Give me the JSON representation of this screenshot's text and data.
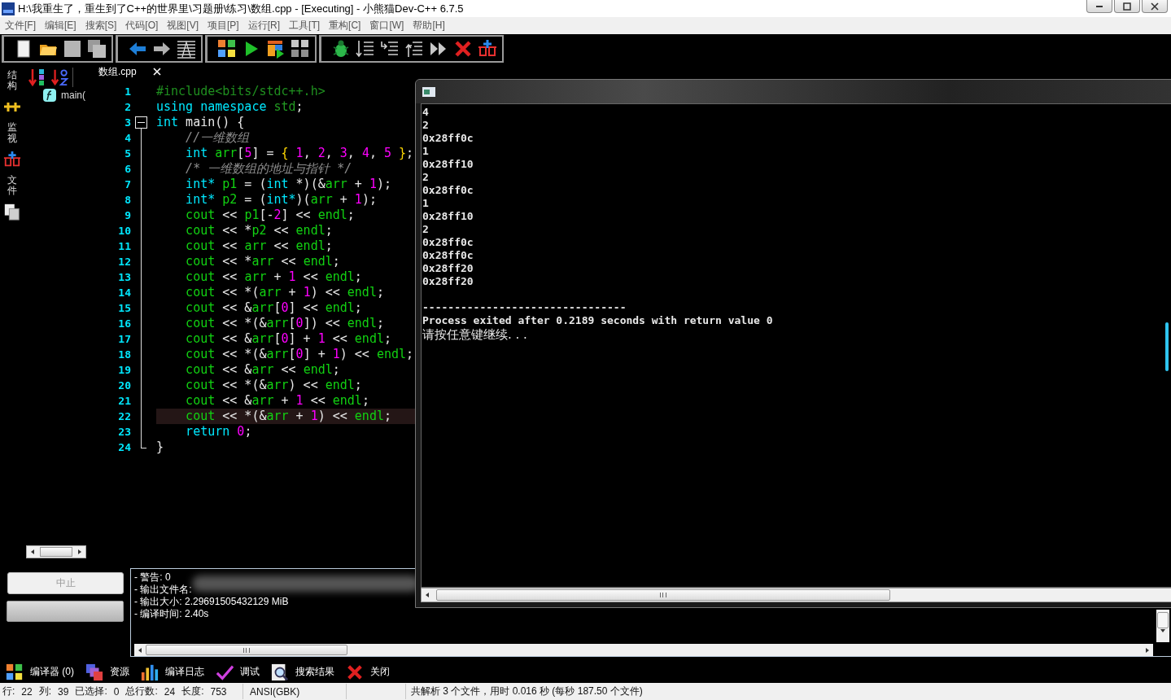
{
  "window": {
    "title": "H:\\我重生了，重生到了C++的世界里\\习题册\\练习\\数组.cpp - [Executing] - 小熊猫Dev-C++ 6.7.5"
  },
  "menu": [
    "文件[F]",
    "编辑[E]",
    "搜索[S]",
    "代码[O]",
    "视图[V]",
    "项目[P]",
    "运行[R]",
    "工具[T]",
    "重构[C]",
    "窗口[W]",
    "帮助[H]"
  ],
  "side_tabs": [
    {
      "kind": "text",
      "label": "结构"
    },
    {
      "kind": "icon"
    },
    {
      "kind": "text",
      "label": "监视"
    },
    {
      "kind": "icon"
    },
    {
      "kind": "text",
      "label": "文件"
    },
    {
      "kind": "icon"
    }
  ],
  "class_browser": {
    "items": [
      {
        "label": "main("
      }
    ]
  },
  "editor": {
    "tab": {
      "label": "数组.cpp"
    },
    "lines": [
      {
        "number": "1",
        "kind": "plain",
        "current": false,
        "tokens": [
          {
            "t": "#include<bits/stdc++.h>",
            "kind": "pre"
          }
        ]
      },
      {
        "number": "2",
        "kind": "plain",
        "current": false,
        "tokens": [
          {
            "t": "using namespace ",
            "kind": "kw"
          },
          {
            "t": "std",
            "kind": "ns"
          },
          {
            "t": ";",
            "kind": "op"
          }
        ]
      },
      {
        "number": "3",
        "kind": "fold-start",
        "current": false,
        "tokens": [
          {
            "t": "int",
            "kind": "kw"
          },
          {
            "t": " main() {",
            "kind": "op"
          }
        ]
      },
      {
        "number": "4",
        "kind": "fold-body",
        "current": false,
        "tokens": [
          {
            "t": "    //一维数组",
            "kind": "cm"
          }
        ]
      },
      {
        "number": "5",
        "kind": "fold-body",
        "current": false,
        "tokens": [
          {
            "t": "    int ",
            "kind": "kw"
          },
          {
            "t": "arr",
            "kind": "id"
          },
          {
            "t": "[",
            "kind": "op"
          },
          {
            "t": "5",
            "kind": "num"
          },
          {
            "t": "] = ",
            "kind": "op"
          },
          {
            "t": "{ ",
            "kind": "br"
          },
          {
            "t": "1",
            "kind": "num"
          },
          {
            "t": ", ",
            "kind": "op"
          },
          {
            "t": "2",
            "kind": "num"
          },
          {
            "t": ", ",
            "kind": "op"
          },
          {
            "t": "3",
            "kind": "num"
          },
          {
            "t": ", ",
            "kind": "op"
          },
          {
            "t": "4",
            "kind": "num"
          },
          {
            "t": ", ",
            "kind": "op"
          },
          {
            "t": "5 ",
            "kind": "num"
          },
          {
            "t": "}",
            "kind": "br"
          },
          {
            "t": ";",
            "kind": "op"
          }
        ]
      },
      {
        "number": "6",
        "kind": "fold-body",
        "current": false,
        "tokens": [
          {
            "t": "    /* 一维数组的地址与指针 */",
            "kind": "cm"
          }
        ]
      },
      {
        "number": "7",
        "kind": "fold-body",
        "current": false,
        "tokens": [
          {
            "t": "    int* ",
            "kind": "kw"
          },
          {
            "t": "p1",
            "kind": "id"
          },
          {
            "t": " = (",
            "kind": "op"
          },
          {
            "t": "int",
            "kind": "kw"
          },
          {
            "t": " *)(&",
            "kind": "op"
          },
          {
            "t": "arr",
            "kind": "id"
          },
          {
            "t": " + ",
            "kind": "op"
          },
          {
            "t": "1",
            "kind": "num"
          },
          {
            "t": ");",
            "kind": "op"
          }
        ]
      },
      {
        "number": "8",
        "kind": "fold-body",
        "current": false,
        "tokens": [
          {
            "t": "    int* ",
            "kind": "kw"
          },
          {
            "t": "p2",
            "kind": "id"
          },
          {
            "t": " = (",
            "kind": "op"
          },
          {
            "t": "int*",
            "kind": "kw"
          },
          {
            "t": ")(",
            "kind": "op"
          },
          {
            "t": "arr",
            "kind": "id"
          },
          {
            "t": " + ",
            "kind": "op"
          },
          {
            "t": "1",
            "kind": "num"
          },
          {
            "t": ");",
            "kind": "op"
          }
        ]
      },
      {
        "number": "9",
        "kind": "fold-body",
        "current": false,
        "tokens": [
          {
            "t": "    cout",
            "kind": "id"
          },
          {
            "t": " << ",
            "kind": "op"
          },
          {
            "t": "p1",
            "kind": "id"
          },
          {
            "t": "[-",
            "kind": "op"
          },
          {
            "t": "2",
            "kind": "num"
          },
          {
            "t": "] << ",
            "kind": "op"
          },
          {
            "t": "endl",
            "kind": "id"
          },
          {
            "t": ";",
            "kind": "op"
          }
        ]
      },
      {
        "number": "10",
        "kind": "fold-body",
        "current": false,
        "tokens": [
          {
            "t": "    cout",
            "kind": "id"
          },
          {
            "t": " << *",
            "kind": "op"
          },
          {
            "t": "p2",
            "kind": "id"
          },
          {
            "t": " << ",
            "kind": "op"
          },
          {
            "t": "endl",
            "kind": "id"
          },
          {
            "t": ";",
            "kind": "op"
          }
        ]
      },
      {
        "number": "11",
        "kind": "fold-body",
        "current": false,
        "tokens": [
          {
            "t": "    cout",
            "kind": "id"
          },
          {
            "t": " << ",
            "kind": "op"
          },
          {
            "t": "arr",
            "kind": "id"
          },
          {
            "t": " << ",
            "kind": "op"
          },
          {
            "t": "endl",
            "kind": "id"
          },
          {
            "t": ";",
            "kind": "op"
          }
        ]
      },
      {
        "number": "12",
        "kind": "fold-body",
        "current": false,
        "tokens": [
          {
            "t": "    cout",
            "kind": "id"
          },
          {
            "t": " << *",
            "kind": "op"
          },
          {
            "t": "arr",
            "kind": "id"
          },
          {
            "t": " << ",
            "kind": "op"
          },
          {
            "t": "endl",
            "kind": "id"
          },
          {
            "t": ";",
            "kind": "op"
          }
        ]
      },
      {
        "number": "13",
        "kind": "fold-body",
        "current": false,
        "tokens": [
          {
            "t": "    cout",
            "kind": "id"
          },
          {
            "t": " << ",
            "kind": "op"
          },
          {
            "t": "arr",
            "kind": "id"
          },
          {
            "t": " + ",
            "kind": "op"
          },
          {
            "t": "1",
            "kind": "num"
          },
          {
            "t": " << ",
            "kind": "op"
          },
          {
            "t": "endl",
            "kind": "id"
          },
          {
            "t": ";",
            "kind": "op"
          }
        ]
      },
      {
        "number": "14",
        "kind": "fold-body",
        "current": false,
        "tokens": [
          {
            "t": "    cout",
            "kind": "id"
          },
          {
            "t": " << *(",
            "kind": "op"
          },
          {
            "t": "arr",
            "kind": "id"
          },
          {
            "t": " + ",
            "kind": "op"
          },
          {
            "t": "1",
            "kind": "num"
          },
          {
            "t": ") << ",
            "kind": "op"
          },
          {
            "t": "endl",
            "kind": "id"
          },
          {
            "t": ";",
            "kind": "op"
          }
        ]
      },
      {
        "number": "15",
        "kind": "fold-body",
        "current": false,
        "tokens": [
          {
            "t": "    cout",
            "kind": "id"
          },
          {
            "t": " << &",
            "kind": "op"
          },
          {
            "t": "arr",
            "kind": "id"
          },
          {
            "t": "[",
            "kind": "op"
          },
          {
            "t": "0",
            "kind": "num"
          },
          {
            "t": "] << ",
            "kind": "op"
          },
          {
            "t": "endl",
            "kind": "id"
          },
          {
            "t": ";",
            "kind": "op"
          }
        ]
      },
      {
        "number": "16",
        "kind": "fold-body",
        "current": false,
        "tokens": [
          {
            "t": "    cout",
            "kind": "id"
          },
          {
            "t": " << *(&",
            "kind": "op"
          },
          {
            "t": "arr",
            "kind": "id"
          },
          {
            "t": "[",
            "kind": "op"
          },
          {
            "t": "0",
            "kind": "num"
          },
          {
            "t": "]) << ",
            "kind": "op"
          },
          {
            "t": "endl",
            "kind": "id"
          },
          {
            "t": ";",
            "kind": "op"
          }
        ]
      },
      {
        "number": "17",
        "kind": "fold-body",
        "current": false,
        "tokens": [
          {
            "t": "    cout",
            "kind": "id"
          },
          {
            "t": " << &",
            "kind": "op"
          },
          {
            "t": "arr",
            "kind": "id"
          },
          {
            "t": "[",
            "kind": "op"
          },
          {
            "t": "0",
            "kind": "num"
          },
          {
            "t": "] + ",
            "kind": "op"
          },
          {
            "t": "1",
            "kind": "num"
          },
          {
            "t": " << ",
            "kind": "op"
          },
          {
            "t": "endl",
            "kind": "id"
          },
          {
            "t": ";",
            "kind": "op"
          }
        ]
      },
      {
        "number": "18",
        "kind": "fold-body",
        "current": false,
        "tokens": [
          {
            "t": "    cout",
            "kind": "id"
          },
          {
            "t": " << *(&",
            "kind": "op"
          },
          {
            "t": "arr",
            "kind": "id"
          },
          {
            "t": "[",
            "kind": "op"
          },
          {
            "t": "0",
            "kind": "num"
          },
          {
            "t": "] + ",
            "kind": "op"
          },
          {
            "t": "1",
            "kind": "num"
          },
          {
            "t": ") << ",
            "kind": "op"
          },
          {
            "t": "endl",
            "kind": "id"
          },
          {
            "t": ";",
            "kind": "op"
          }
        ]
      },
      {
        "number": "19",
        "kind": "fold-body",
        "current": false,
        "tokens": [
          {
            "t": "    cout",
            "kind": "id"
          },
          {
            "t": " << &",
            "kind": "op"
          },
          {
            "t": "arr",
            "kind": "id"
          },
          {
            "t": " << ",
            "kind": "op"
          },
          {
            "t": "endl",
            "kind": "id"
          },
          {
            "t": ";",
            "kind": "op"
          }
        ]
      },
      {
        "number": "20",
        "kind": "fold-body",
        "current": false,
        "tokens": [
          {
            "t": "    cout",
            "kind": "id"
          },
          {
            "t": " << *(&",
            "kind": "op"
          },
          {
            "t": "arr",
            "kind": "id"
          },
          {
            "t": ") << ",
            "kind": "op"
          },
          {
            "t": "endl",
            "kind": "id"
          },
          {
            "t": ";",
            "kind": "op"
          }
        ]
      },
      {
        "number": "21",
        "kind": "fold-body",
        "current": false,
        "tokens": [
          {
            "t": "    cout",
            "kind": "id"
          },
          {
            "t": " << &",
            "kind": "op"
          },
          {
            "t": "arr",
            "kind": "id"
          },
          {
            "t": " + ",
            "kind": "op"
          },
          {
            "t": "1",
            "kind": "num"
          },
          {
            "t": " << ",
            "kind": "op"
          },
          {
            "t": "endl",
            "kind": "id"
          },
          {
            "t": ";",
            "kind": "op"
          }
        ]
      },
      {
        "number": "22",
        "kind": "fold-body",
        "current": true,
        "tokens": [
          {
            "t": "    cout",
            "kind": "id"
          },
          {
            "t": " << *(&",
            "kind": "op"
          },
          {
            "t": "arr",
            "kind": "id"
          },
          {
            "t": " + ",
            "kind": "op"
          },
          {
            "t": "1",
            "kind": "num"
          },
          {
            "t": ") << ",
            "kind": "op"
          },
          {
            "t": "endl",
            "kind": "id"
          },
          {
            "t": ";",
            "kind": "op"
          }
        ]
      },
      {
        "number": "23",
        "kind": "fold-body",
        "current": false,
        "tokens": [
          {
            "t": "    return ",
            "kind": "kw"
          },
          {
            "t": "0",
            "kind": "num"
          },
          {
            "t": ";",
            "kind": "op"
          }
        ]
      },
      {
        "number": "24",
        "kind": "fold-end",
        "current": false,
        "tokens": [
          {
            "t": "}",
            "kind": "op"
          }
        ]
      }
    ]
  },
  "console": {
    "output": [
      "4",
      "2",
      "0x28ff0c",
      "1",
      "0x28ff10",
      "2",
      "0x28ff0c",
      "1",
      "0x28ff10",
      "2",
      "0x28ff0c",
      "0x28ff0c",
      "0x28ff20",
      "0x28ff20"
    ],
    "separator": "--------------------------------",
    "exit_message": "Process exited after 0.2189 seconds with return value 0",
    "prompt": "请按任意键继续. . ."
  },
  "stop_button": {
    "label": "中止",
    "disabled": true
  },
  "progress_bar": {
    "level": 1
  },
  "compile_log": [
    "- 警告: 0",
    "- 输出文件名:",
    "- 输出大小: 2.29691505432129 MiB",
    "- 编译时间: 2.40s"
  ],
  "bottom_tabs": [
    {
      "label": "编译器 (0)"
    },
    {
      "label": "资源"
    },
    {
      "label": "编译日志"
    },
    {
      "label": "调试"
    },
    {
      "label": "搜索结果"
    },
    {
      "label": "关闭"
    }
  ],
  "status_bar": {
    "fields": [
      {
        "label": "行:",
        "value": "22"
      },
      {
        "label": "列:",
        "value": "39"
      },
      {
        "label": "已选择:",
        "value": "0"
      },
      {
        "label": "总行数:",
        "value": "24"
      },
      {
        "label": "长度:",
        "value": "753"
      }
    ],
    "encoding": "ANSI(GBK)",
    "parse_info": "共解析 3 个文件，用时 0.016 秒 (每秒 187.50 个文件)"
  }
}
